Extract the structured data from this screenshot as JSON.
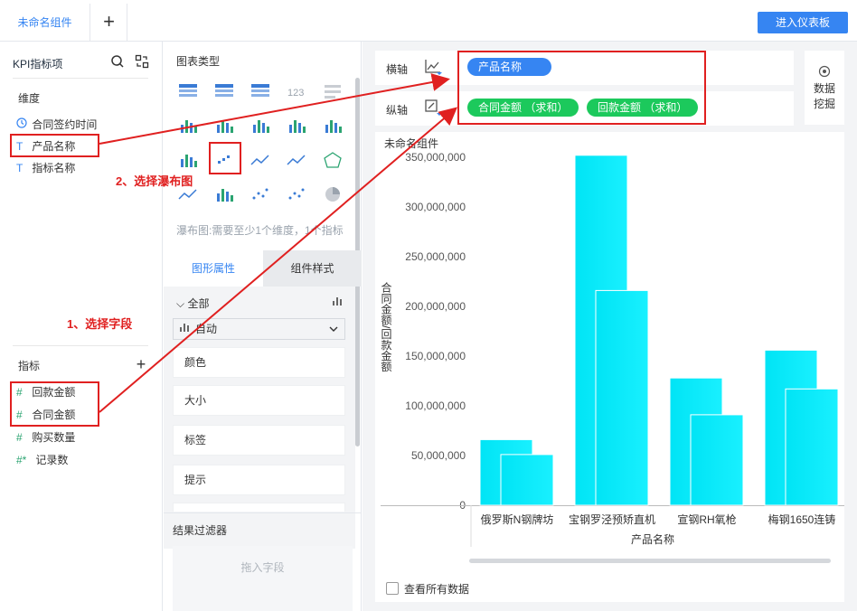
{
  "tabs": {
    "active": "未命名组件",
    "add": "+"
  },
  "enter_button": "进入仪表板",
  "left_panel": {
    "header": "KPI指标项",
    "dimension_title": "维度",
    "dimensions": [
      {
        "type": "clock",
        "label": "合同签约时间"
      },
      {
        "type": "T",
        "label": "产品名称"
      },
      {
        "type": "T",
        "label": "指标名称"
      }
    ],
    "measure_title": "指标",
    "measures": [
      {
        "icon": "#",
        "label": "回款金额"
      },
      {
        "icon": "#",
        "label": "合同金额"
      },
      {
        "icon": "#",
        "label": "购买数量"
      },
      {
        "icon": "#*",
        "label": "记录数"
      }
    ]
  },
  "mid_panel": {
    "chart_type_title": "图表类型",
    "hint": "瀑布图:需要至少1个维度，1个指标",
    "tab_graphic": "图形属性",
    "tab_style": "组件样式",
    "all_label": "全部",
    "select_value": "自动",
    "props": [
      "颜色",
      "大小",
      "标签",
      "提示"
    ],
    "filter_title": "结果过滤器",
    "filter_placeholder": "拖入字段"
  },
  "axis": {
    "x_label": "横轴",
    "y_label": "纵轴",
    "x_fields": [
      "产品名称"
    ],
    "y_fields": [
      "合同金额 （求和）",
      "回款金额 （求和）"
    ]
  },
  "mining": {
    "line1": "数据",
    "line2": "挖掘"
  },
  "annotations": {
    "step1": "1、选择字段",
    "step2": "2、选择瀑布图"
  },
  "view_all": "查看所有数据",
  "colors": {
    "accent": "#3685f2",
    "pill_green": "#1cc95c",
    "bar_start": "#00e4f5",
    "bar_end": "#19f0ff",
    "annotation": "#e02020"
  },
  "chart_data": {
    "type": "bar",
    "title": "未命名组件",
    "xlabel": "产品名称",
    "ylabel": "合同金额/回款金额",
    "categories": [
      "俄罗斯N钢牌坊",
      "宝钢罗泾预矫直机",
      "宣钢RH氧枪",
      "梅钢1650连铸"
    ],
    "series": [
      {
        "name": "合同金额 （求和）",
        "values": [
          66000000,
          352000000,
          128000000,
          156000000
        ]
      },
      {
        "name": "回款金额 （求和）",
        "values": [
          51000000,
          216000000,
          91000000,
          117000000
        ]
      }
    ],
    "ylim": [
      0,
      350000000
    ],
    "yticks": [
      "0",
      "50,000,000",
      "100,000,000",
      "150,000,000",
      "200,000,000",
      "250,000,000",
      "300,000,000",
      "350,000,000"
    ],
    "ytick_values": [
      0,
      50000000,
      100000000,
      150000000,
      200000000,
      250000000,
      300000000,
      350000000
    ]
  }
}
